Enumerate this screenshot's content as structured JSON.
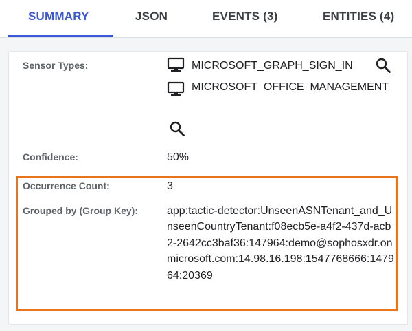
{
  "tabs": [
    {
      "label": "SUMMARY",
      "active": true
    },
    {
      "label": "JSON",
      "active": false
    },
    {
      "label": "EVENTS (3)",
      "active": false
    },
    {
      "label": "ENTITIES (4)",
      "active": false
    }
  ],
  "colors": {
    "accent": "#3b57d6",
    "highlight": "#e8741c"
  },
  "details": {
    "sensor_types_label": "Sensor Types:",
    "sensor_types": [
      {
        "name": "MICROSOFT_GRAPH_SIGN_IN",
        "icon": "monitor-icon"
      },
      {
        "name": "MICROSOFT_OFFICE_MANAGEMENT",
        "icon": "monitor-icon"
      }
    ],
    "confidence_label": "Confidence:",
    "confidence": "50%",
    "occurrence_label": "Occurrence Count:",
    "occurrence": "3",
    "group_key_label": "Grouped by (Group Key):",
    "group_key": "app:tactic-detector:UnseenASNTenant_and_UnseenCountryTenant:f08ecb5e-a4f2-437d-acb2-2642cc3baf36:147964:demo@sophosxdr.onmicrosoft.com:14.98.16.198:1547768666:147964:20369"
  }
}
